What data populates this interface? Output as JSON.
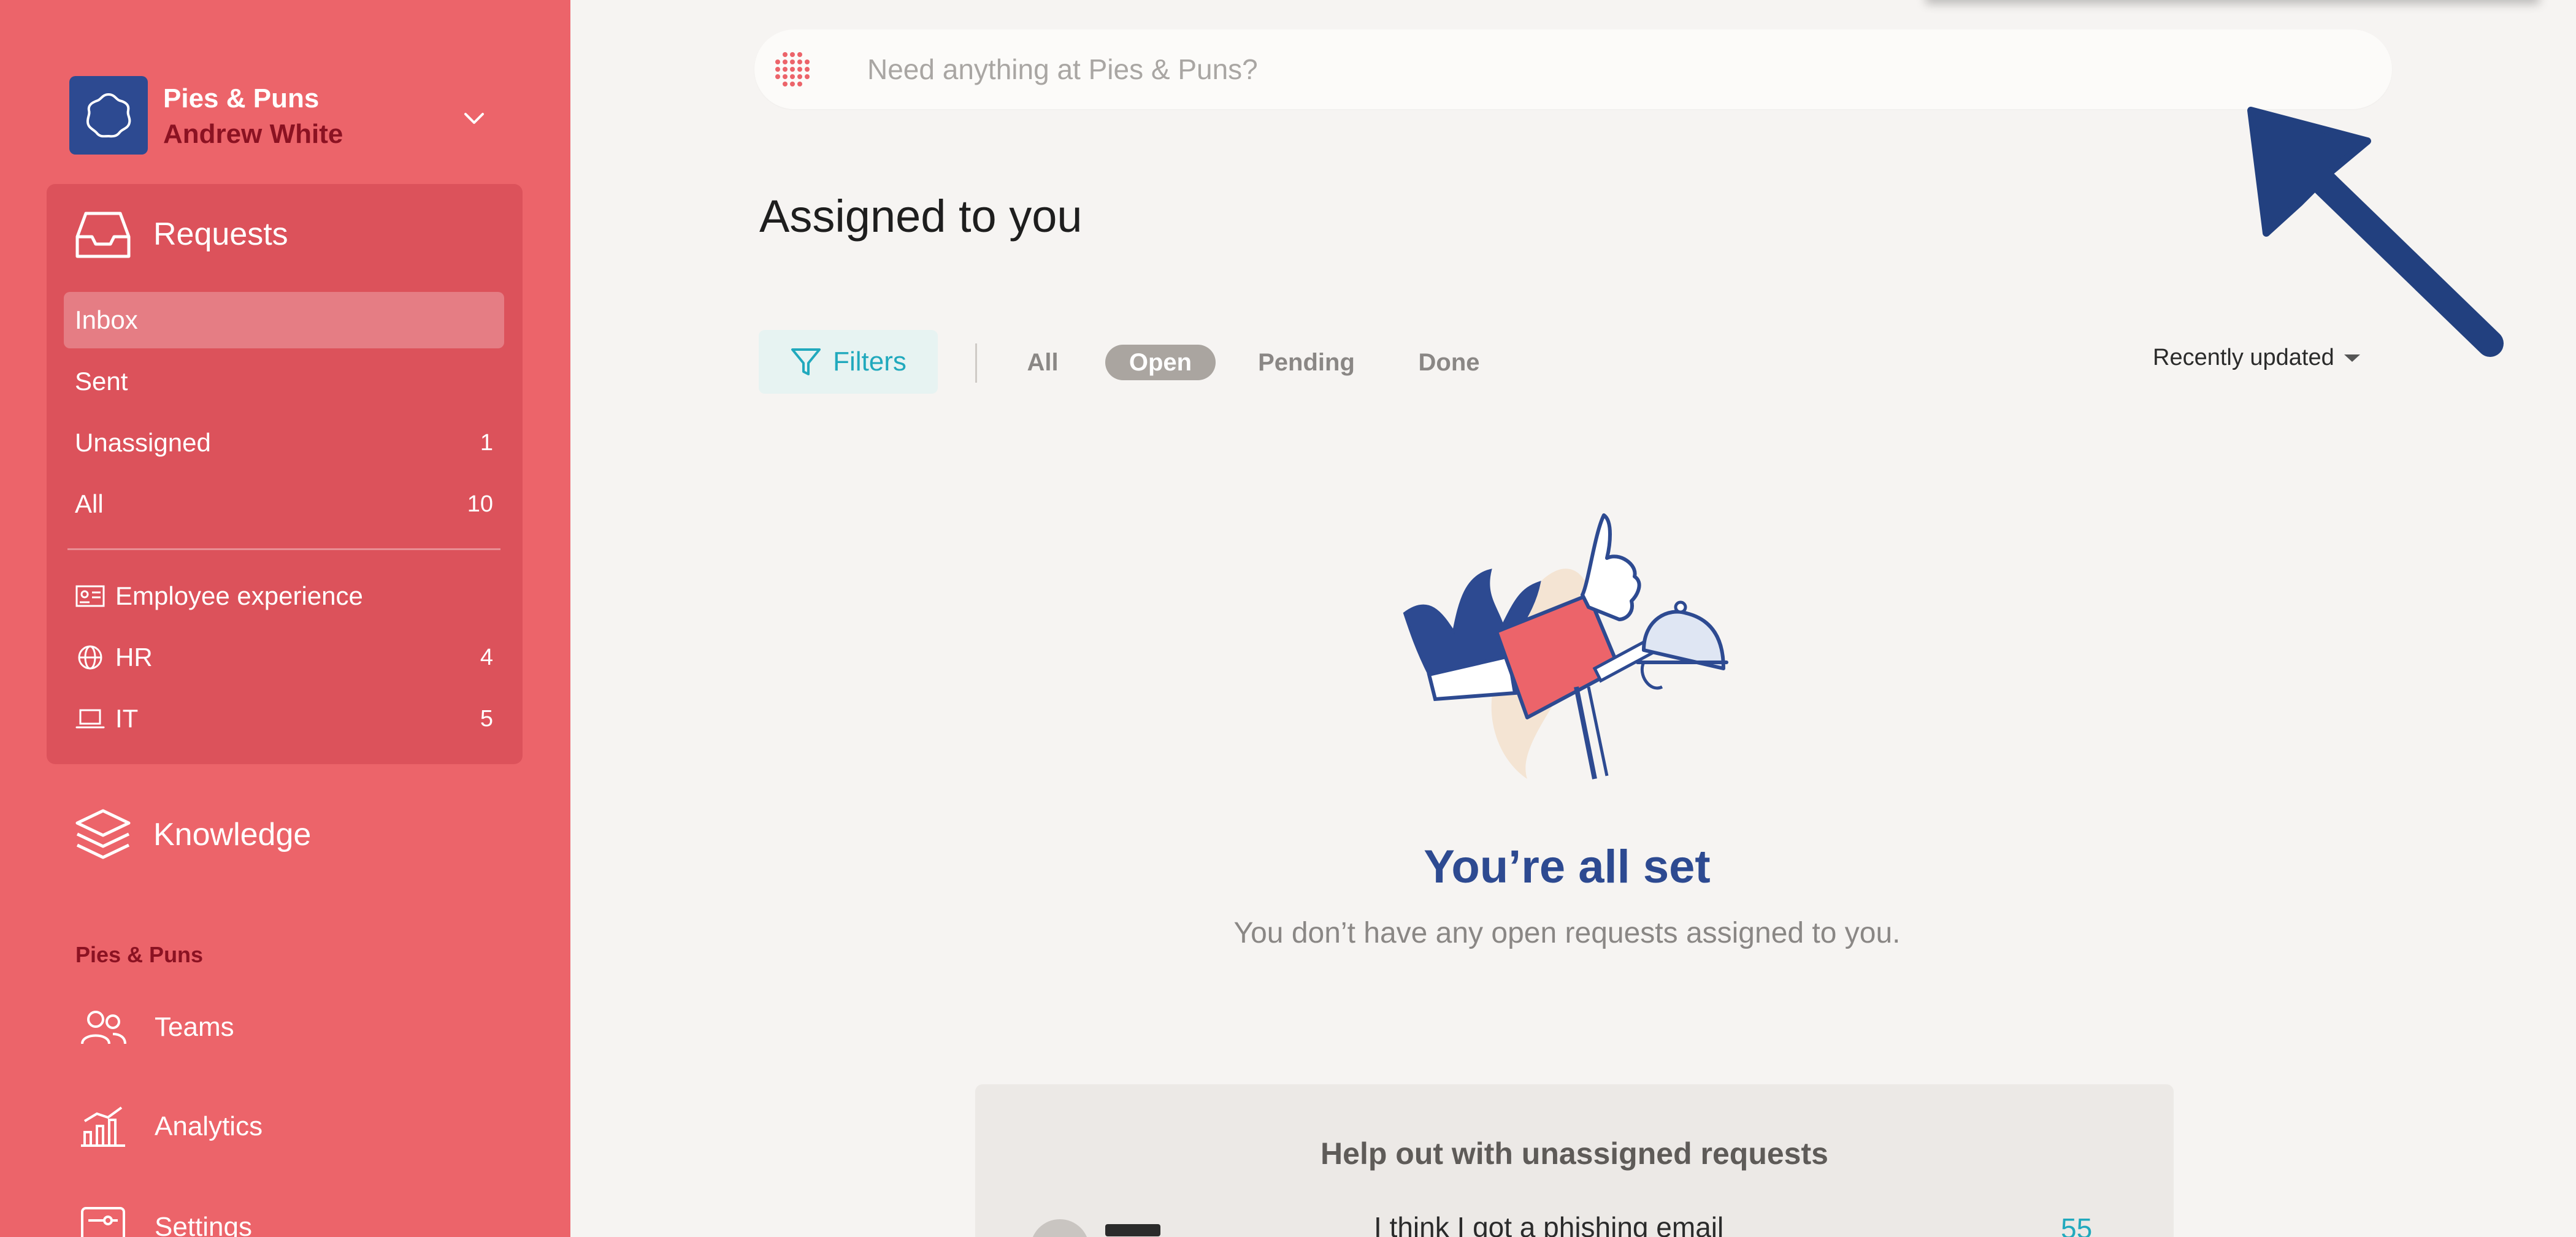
{
  "workspace": {
    "name": "Pies & Puns",
    "user": "Andrew White"
  },
  "sidebar": {
    "requests_label": "Requests",
    "items": [
      {
        "label": "Inbox",
        "count": ""
      },
      {
        "label": "Sent",
        "count": ""
      },
      {
        "label": "Unassigned",
        "count": "1"
      },
      {
        "label": "All",
        "count": "10"
      }
    ],
    "categories": [
      {
        "label": "Employee experience",
        "count": "",
        "icon": "id-card-icon"
      },
      {
        "label": "HR",
        "count": "4",
        "icon": "globe-icon"
      },
      {
        "label": "IT",
        "count": "5",
        "icon": "laptop-icon"
      }
    ],
    "knowledge_label": "Knowledge",
    "section_caption": "Pies & Puns",
    "footer_items": [
      {
        "label": "Teams",
        "icon": "people-icon"
      },
      {
        "label": "Analytics",
        "icon": "chart-icon"
      },
      {
        "label": "Settings",
        "icon": "settings-icon"
      }
    ]
  },
  "search": {
    "placeholder": "Need anything at Pies & Puns?"
  },
  "main": {
    "title": "Assigned to you",
    "filters_label": "Filters",
    "tabs": [
      {
        "label": "All",
        "active": false
      },
      {
        "label": "Open",
        "active": true
      },
      {
        "label": "Pending",
        "active": false
      },
      {
        "label": "Done",
        "active": false
      }
    ],
    "sort_label": "Recently updated",
    "empty_title": "You’re all set",
    "empty_subtitle": "You don’t have any open requests assigned to you.",
    "help_card": {
      "title": "Help out with unassigned requests",
      "request_title": "I think I got a phishing email",
      "number": "55"
    }
  },
  "colors": {
    "sidebar_bg": "#ec646a",
    "panel_bg": "#dc525b",
    "brand_blue": "#2d4a91",
    "accent_teal": "#21a9bd",
    "user_name_red": "#8b1222"
  }
}
